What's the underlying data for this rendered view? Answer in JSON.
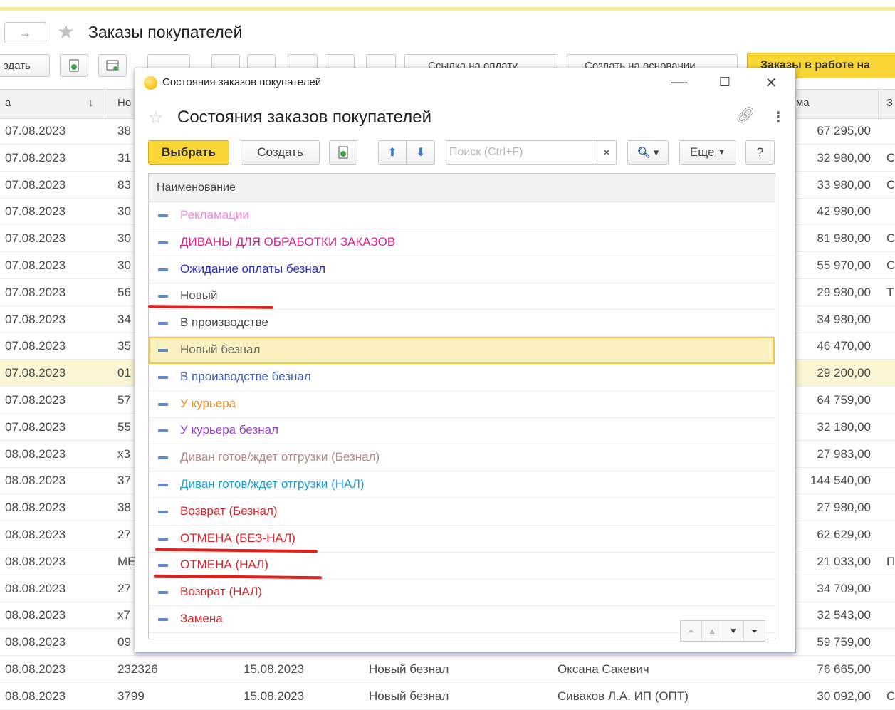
{
  "window": {
    "title": "Заказы покупателей"
  },
  "toolbar": {
    "create_label": "здать",
    "payment_link_label": "Ссылка на оплату",
    "create_based_label": "Создать на основании",
    "orders_in_work_label": "Заказы в работе на"
  },
  "table": {
    "headers": {
      "date": "а",
      "number": "Но",
      "sum": "ма",
      "last": "З"
    },
    "rows": [
      {
        "date": "07.08.2023",
        "number": "38",
        "date2": "",
        "status": "",
        "client": "",
        "sum": "67 295,00",
        "last": ""
      },
      {
        "date": "07.08.2023",
        "number": "31",
        "date2": "",
        "status": "",
        "client": "",
        "sum": "32 980,00",
        "last": "С"
      },
      {
        "date": "07.08.2023",
        "number": "83",
        "date2": "",
        "status": "",
        "client": "",
        "sum": "33 980,00",
        "last": "С"
      },
      {
        "date": "07.08.2023",
        "number": "30",
        "date2": "",
        "status": "",
        "client": "",
        "sum": "42 980,00",
        "last": ""
      },
      {
        "date": "07.08.2023",
        "number": "30",
        "date2": "",
        "status": "",
        "client": "",
        "sum": "81 980,00",
        "last": "С"
      },
      {
        "date": "07.08.2023",
        "number": "30",
        "date2": "",
        "status": "",
        "client": "",
        "sum": "55 970,00",
        "last": "С"
      },
      {
        "date": "07.08.2023",
        "number": "56",
        "date2": "",
        "status": "",
        "client": "",
        "sum": "29 980,00",
        "last": "Т"
      },
      {
        "date": "07.08.2023",
        "number": "34",
        "date2": "",
        "status": "",
        "client": "",
        "sum": "34 980,00",
        "last": ""
      },
      {
        "date": "07.08.2023",
        "number": "35",
        "date2": "",
        "status": "",
        "client": "",
        "sum": "46 470,00",
        "last": ""
      },
      {
        "date": "07.08.2023",
        "number": "01",
        "date2": "",
        "status": "",
        "client": "",
        "sum": "29 200,00",
        "last": ""
      },
      {
        "date": "07.08.2023",
        "number": "57",
        "date2": "",
        "status": "",
        "client": "",
        "sum": "64 759,00",
        "last": ""
      },
      {
        "date": "07.08.2023",
        "number": "55",
        "date2": "",
        "status": "",
        "client": "",
        "sum": "32 180,00",
        "last": ""
      },
      {
        "date": "08.08.2023",
        "number": "x3",
        "date2": "",
        "status": "",
        "client": "",
        "sum": "27 983,00",
        "last": ""
      },
      {
        "date": "08.08.2023",
        "number": "37",
        "date2": "",
        "status": "",
        "client": "",
        "sum": "144 540,00",
        "last": ""
      },
      {
        "date": "08.08.2023",
        "number": "38",
        "date2": "",
        "status": "",
        "client": "",
        "sum": "27 980,00",
        "last": ""
      },
      {
        "date": "08.08.2023",
        "number": "27",
        "date2": "",
        "status": "",
        "client": "",
        "sum": "62 629,00",
        "last": ""
      },
      {
        "date": "08.08.2023",
        "number": "МЕ",
        "date2": "",
        "status": "",
        "client": "",
        "sum": "21 033,00",
        "last": "П"
      },
      {
        "date": "08.08.2023",
        "number": "27",
        "date2": "",
        "status": "",
        "client": "",
        "sum": "34 709,00",
        "last": ""
      },
      {
        "date": "08.08.2023",
        "number": "x7",
        "date2": "",
        "status": "",
        "client": "",
        "sum": "32 543,00",
        "last": ""
      },
      {
        "date": "08.08.2023",
        "number": "09",
        "date2": "",
        "status": "",
        "client": "",
        "sum": "59 759,00",
        "last": ""
      },
      {
        "date": "08.08.2023",
        "number": "232326",
        "date2": "15.08.2023",
        "status": "Новый безнал",
        "client": "Оксана Сакевич",
        "sum": "76 665,00",
        "last": ""
      },
      {
        "date": "08.08.2023",
        "number": "3799",
        "date2": "15.08.2023",
        "status": "Новый безнал",
        "client": "Сиваков Л.А. ИП (ОПТ)",
        "sum": "30 092,00",
        "last": "С"
      }
    ]
  },
  "modal": {
    "window_title": "Состояния заказов покупателей",
    "title": "Состояния заказов покупателей",
    "select_label": "Выбрать",
    "create_label": "Создать",
    "search_placeholder": "Поиск (Ctrl+F)",
    "more_label": "Еще",
    "help_label": "?",
    "column_header": "Наименование",
    "items": [
      {
        "name": "Рекламации",
        "color": "#f08ad2"
      },
      {
        "name": "ДИВАНЫ ДЛЯ ОБРАБОТКИ ЗАКАЗОВ",
        "color": "#e0208a"
      },
      {
        "name": "Ожидание оплаты безнал",
        "color": "#2630c8"
      },
      {
        "name": "Новый",
        "color": "#555555"
      },
      {
        "name": "В производстве",
        "color": "#444444"
      },
      {
        "name": "Новый безнал",
        "color": "#666666"
      },
      {
        "name": "В производстве безнал",
        "color": "#3d5fbf"
      },
      {
        "name": "У курьера",
        "color": "#e58a1c"
      },
      {
        "name": "У курьера безнал",
        "color": "#9b3fd4"
      },
      {
        "name": "Диван готов/ждет отгрузки (Безнал)",
        "color": "#b38a8a"
      },
      {
        "name": "Диван готов/ждет отгрузки (НАЛ)",
        "color": "#1aa0d8"
      },
      {
        "name": "Возврат (Безнал)",
        "color": "#d8262a"
      },
      {
        "name": "ОТМЕНА (БЕЗ-НАЛ)",
        "color": "#d8262a"
      },
      {
        "name": "ОТМЕНА (НАЛ)",
        "color": "#d8262a"
      },
      {
        "name": "Возврат (НАЛ)",
        "color": "#d8262a"
      },
      {
        "name": "Замена",
        "color": "#d8262a"
      }
    ],
    "selected_index": 5
  },
  "colors": {
    "accent_yellow": "#f9d535",
    "annotation_red": "#e0201d"
  }
}
